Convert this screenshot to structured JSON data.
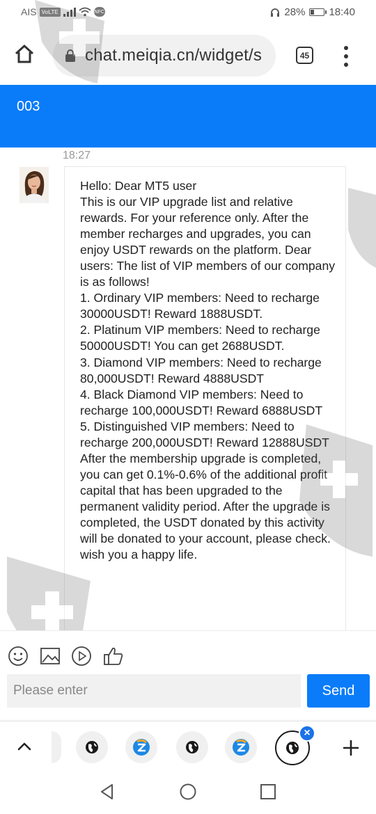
{
  "status_bar": {
    "carrier": "AIS",
    "volte": "VoLTE",
    "nfc": "NFC",
    "battery_text": "28%",
    "battery_level": 0.28,
    "time": "18:40"
  },
  "browser": {
    "url": "chat.meiqia.cn/widget/s",
    "tab_count": "45"
  },
  "chat": {
    "title": "003",
    "message": {
      "time": "18:27",
      "text": "Hello: Dear MT5 user\nThis is our VIP upgrade list and relative rewards. For your reference only. After the member recharges and upgrades, you can enjoy USDT rewards on the platform. Dear users: The list of VIP members of our company is as follows!\n1. Ordinary VIP members: Need to recharge 30000USDT! Reward 1888USDT.\n2. Platinum VIP members: Need to recharge 50000USDT! You can get 2688USDT.\n3. Diamond VIP members: Need to recharge 80,000USDT! Reward 4888USDT\n4. Black Diamond VIP members: Need to recharge 100,000USDT! Reward 6888USDT\n5. Distinguished VIP members: Need to recharge 200,000USDT! Reward 12888USDT\nAfter the membership upgrade is completed, you can get 0.1%-0.6% of the additional profit capital that has been upgraded to the permanent validity period. After the upgrade is completed, the USDT donated by this activity will be donated to your account, please check. wish you a happy life."
    }
  },
  "composer": {
    "placeholder": "Please enter",
    "send_label": "Send",
    "tools": [
      "emoji-icon",
      "image-icon",
      "play-icon",
      "thumbs-up-icon"
    ]
  },
  "tab_strip": {
    "close_label": "×"
  },
  "colors": {
    "accent": "#0a7cf9",
    "tab_badge": "#1a73e8"
  }
}
